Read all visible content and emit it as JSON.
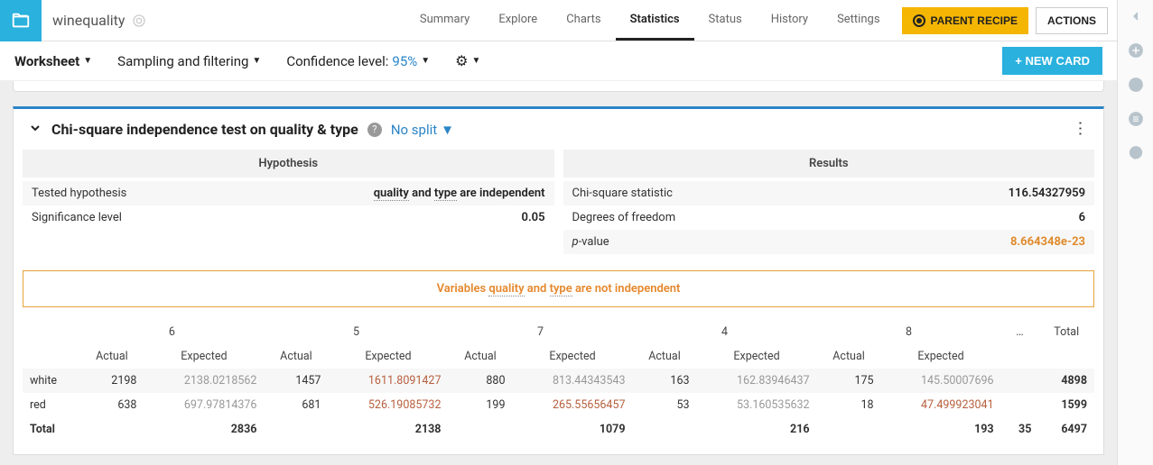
{
  "header": {
    "dataset": "winequality",
    "tabs": [
      "Summary",
      "Explore",
      "Charts",
      "Statistics",
      "Status",
      "History",
      "Settings"
    ],
    "active_tab": "Statistics",
    "parent_recipe": "PARENT RECIPE",
    "actions": "ACTIONS"
  },
  "toolbar": {
    "worksheet": "Worksheet",
    "sampling": "Sampling and filtering",
    "confidence_label": "Confidence level:",
    "confidence_value": "95%",
    "new_card": "+ NEW CARD"
  },
  "card": {
    "title": "Chi-square independence test on quality & type",
    "split": "No split",
    "hypothesis": {
      "header": "Hypothesis",
      "tested_label": "Tested hypothesis",
      "tested_var1": "quality",
      "tested_mid": " and ",
      "tested_var2": "type",
      "tested_suffix": " are independent",
      "sig_label": "Significance level",
      "sig_value": "0.05"
    },
    "results": {
      "header": "Results",
      "chi_label": "Chi-square statistic",
      "chi_value": "116.54327959",
      "dof_label": "Degrees of freedom",
      "dof_value": "6",
      "pval_label_prefix": "p",
      "pval_label_suffix": "-value",
      "pval_value": "8.664348e-23"
    },
    "conclusion_pre": "Variables ",
    "conclusion_v1": "quality",
    "conclusion_mid": " and ",
    "conclusion_v2": "type",
    "conclusion_post": " are not independent",
    "table": {
      "groups": [
        "6",
        "5",
        "7",
        "4",
        "8",
        "…",
        "Total"
      ],
      "subcols": [
        "Actual",
        "Expected"
      ],
      "rows": [
        {
          "label": "white",
          "cells": [
            {
              "a": "2198",
              "e": "2138.0218562",
              "sig": false
            },
            {
              "a": "1457",
              "e": "1611.8091427",
              "sig": true
            },
            {
              "a": "880",
              "e": "813.44343543",
              "sig": false
            },
            {
              "a": "163",
              "e": "162.83946437",
              "sig": false
            },
            {
              "a": "175",
              "e": "145.50007696",
              "sig": false
            }
          ],
          "total": "4898"
        },
        {
          "label": "red",
          "cells": [
            {
              "a": "638",
              "e": "697.97814376",
              "sig": false
            },
            {
              "a": "681",
              "e": "526.19085732",
              "sig": true
            },
            {
              "a": "199",
              "e": "265.55656457",
              "sig": true
            },
            {
              "a": "53",
              "e": "53.160535632",
              "sig": false
            },
            {
              "a": "18",
              "e": "47.499923041",
              "sig": true
            }
          ],
          "total": "1599"
        }
      ],
      "totals": {
        "label": "Total",
        "values": [
          "2836",
          "2138",
          "1079",
          "216",
          "193",
          "35",
          "6497"
        ]
      }
    }
  }
}
